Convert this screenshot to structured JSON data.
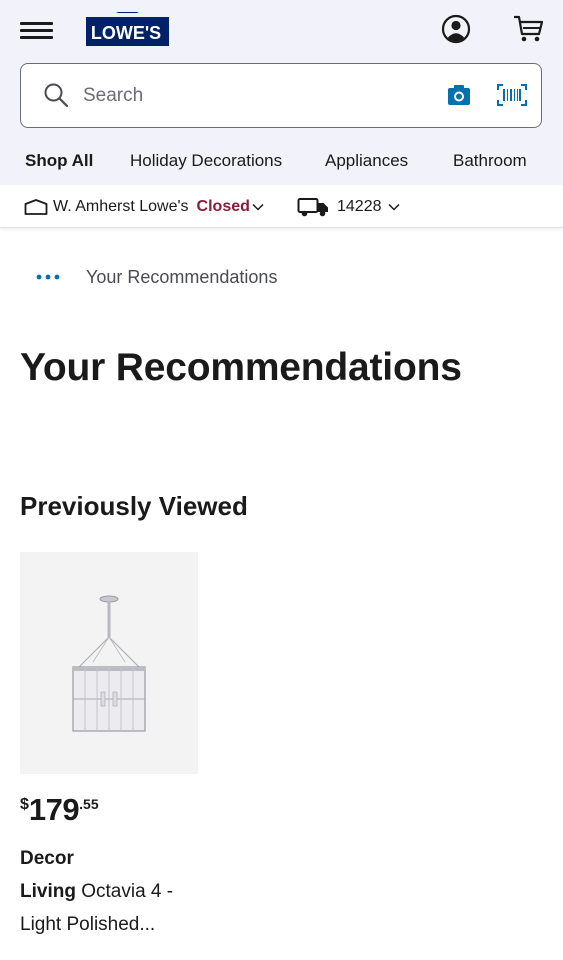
{
  "header": {
    "logo_text": "LOWE'S",
    "brand_color": "#012169",
    "search": {
      "placeholder": "Search"
    },
    "icons": [
      "hamburger-menu-icon",
      "account-icon",
      "cart-icon",
      "search-icon",
      "camera-icon",
      "barcode-scan-icon"
    ]
  },
  "categories": [
    {
      "label": "Shop All"
    },
    {
      "label": "Holiday Decorations"
    },
    {
      "label": "Appliances"
    },
    {
      "label": "Bathroom"
    }
  ],
  "store": {
    "name": "W. Amherst Lowe's",
    "status": "Closed",
    "status_color": "#8a1c3a",
    "zip": "14228"
  },
  "breadcrumb": {
    "current": "Your Recommendations"
  },
  "page": {
    "title": "Your Recommendations",
    "section_title": "Previously Viewed"
  },
  "products": [
    {
      "price_symbol": "$",
      "price_dollars": "179",
      "price_cents": ".55",
      "brand_line1": "Decor",
      "brand_line2": "Living",
      "title_line2_rest": " Octavia 4 -",
      "title_line3": "Light Polished..."
    }
  ]
}
